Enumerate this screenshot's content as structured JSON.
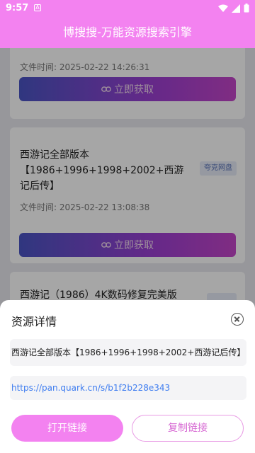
{
  "status_bar": {
    "time": "9:57",
    "app_icon_letter": "A"
  },
  "header": {
    "title": "博搜搜-万能资源搜索引擎"
  },
  "results": [
    {
      "title": "",
      "tag": "",
      "time": "文件时间: 2025-02-22 14:26:31",
      "button_label": "立即获取"
    },
    {
      "title": "西游记全部版本【1986+1996+1998+2002+西游记后传】",
      "tag": "夸克网盘",
      "time": "文件时间: 2025-02-22 13:08:38",
      "button_label": "立即获取"
    },
    {
      "title": "西游记（1986）4K数码修复完美版",
      "tag": "",
      "time": "",
      "button_label": ""
    }
  ],
  "detail_sheet": {
    "title": "资源详情",
    "resource_name": "西游记全部版本【1986+1996+1998+2002+西游记后传】",
    "link": "https://pan.quark.cn/s/b1f2b228e343",
    "open_label": "打开链接",
    "copy_label": "复制链接"
  },
  "colors": {
    "accent": "#f382f0",
    "link": "#3d7cf0"
  },
  "icons": [
    "wifi-icon",
    "signal-icon",
    "battery-icon",
    "link-icon",
    "close-icon"
  ]
}
